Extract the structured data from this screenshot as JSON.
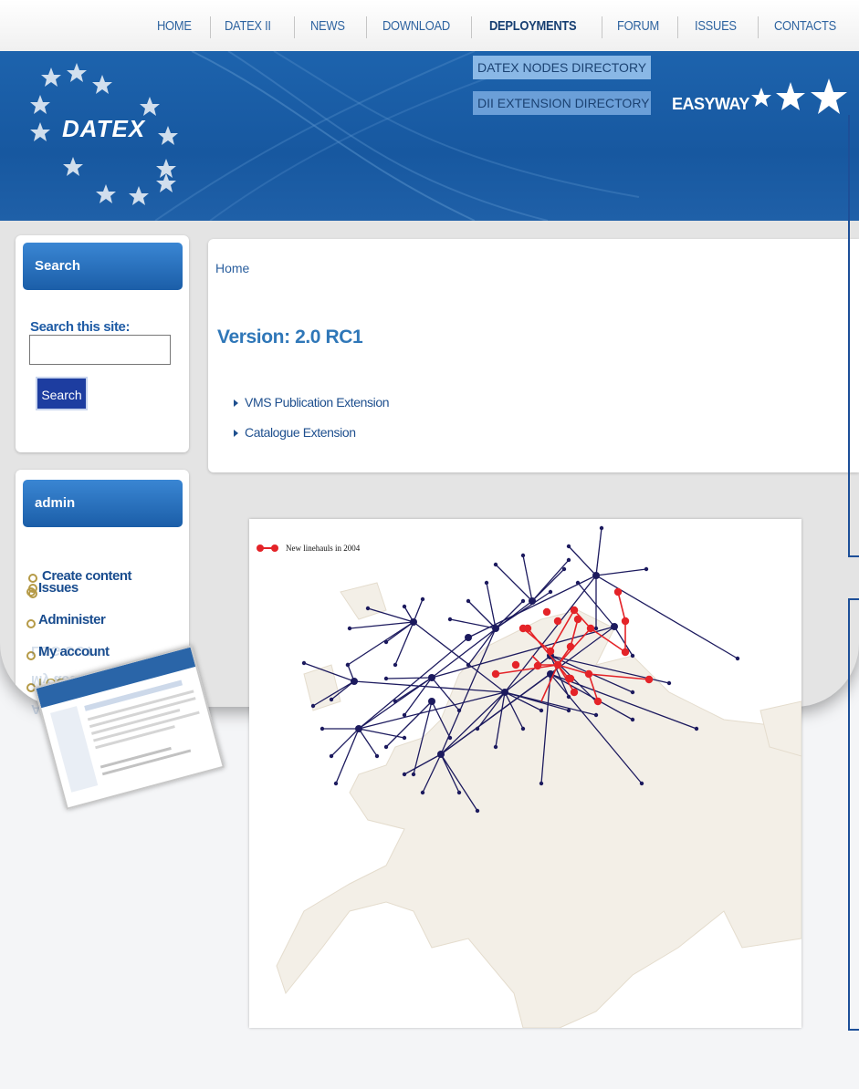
{
  "nav": {
    "items": [
      "HOME",
      "DATEX II",
      "NEWS",
      "DOWNLOAD",
      "DEPLOYMENTS",
      "FORUM",
      "ISSUES",
      "CONTACTS"
    ],
    "active": "DEPLOYMENTS",
    "submenu": [
      "DATEX NODES DIRECTORY",
      "DII EXTENSION DIRECTORY"
    ]
  },
  "banner": {
    "logo_text": "DATEX",
    "partner_text": "EASYWAY"
  },
  "search_block": {
    "title": "Search",
    "label": "Search this site:",
    "button": "Search",
    "input_value": ""
  },
  "admin_block": {
    "title": "admin",
    "items": [
      "Create content",
      "Issues",
      "Administer",
      "My account",
      "LOG OUT"
    ]
  },
  "main": {
    "breadcrumb": "Home",
    "title": "Version: 2.0 RC1",
    "links": [
      "VMS Publication Extension",
      "Catalogue Extension"
    ]
  },
  "map": {
    "legend": "New linehauls in 2004",
    "line_color": "#1c1a5e",
    "highlight_color": "#e42328"
  },
  "colors": {
    "brand_blue": "#1758a0",
    "title_blue": "#2f77b8",
    "bullet_gold": "#b59a47"
  }
}
